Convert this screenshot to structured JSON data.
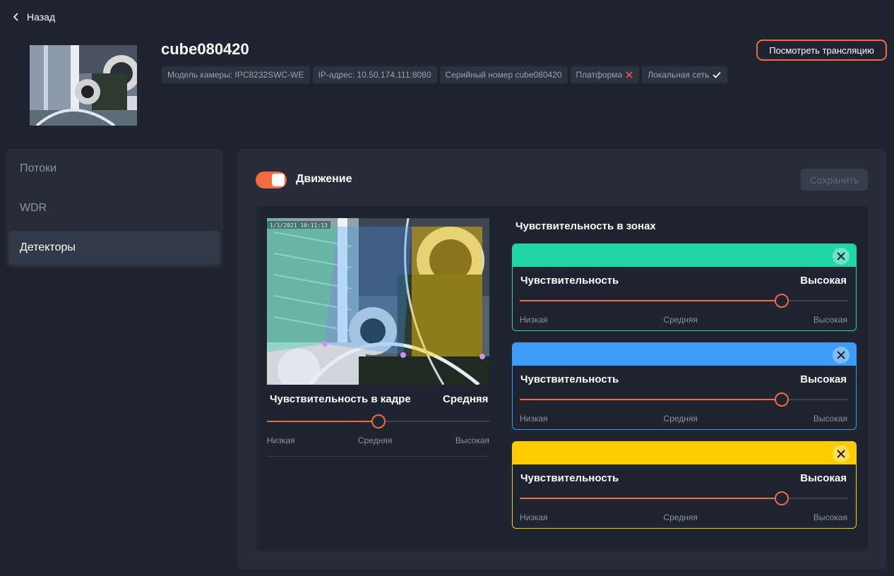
{
  "nav": {
    "back_label": "Назад"
  },
  "camera": {
    "name": "cube080420",
    "chips": [
      {
        "text": "Модель камеры: IPC8232SWC-WE",
        "icon": ""
      },
      {
        "text": "IP-адрес: 10.50.174.111:8080",
        "icon": ""
      },
      {
        "text": "Серийный номер cube080420",
        "icon": ""
      },
      {
        "text": "Платформа",
        "icon": "cross-icon"
      },
      {
        "text": "Локальная сеть",
        "icon": "check-icon"
      }
    ],
    "watch_button": "Посмотреть трансляцию"
  },
  "sidebar": {
    "items": [
      {
        "label": "Потоки",
        "active": false
      },
      {
        "label": "WDR",
        "active": false
      },
      {
        "label": "Детекторы",
        "active": true
      }
    ]
  },
  "detector": {
    "toggle_on": true,
    "title": "Движение",
    "save_label": "Сохранить",
    "preview_timestamp": "1/1/2021 10:11:13",
    "frame_sensitivity": {
      "label": "Чувствительность в кадре",
      "value": "Средняя",
      "level": 0.5,
      "scale": [
        "Низкая",
        "Средняя",
        "Высокая"
      ]
    },
    "zones_title": "Чувствительность в зонах",
    "zones": [
      {
        "color": "#1fd6a6",
        "label": "Чувствительность",
        "value": "Высокая",
        "level": 0.8,
        "scale": [
          "Низкая",
          "Средняя",
          "Высокая"
        ]
      },
      {
        "color": "#3d9cf5",
        "label": "Чувствительность",
        "value": "Высокая",
        "level": 0.8,
        "scale": [
          "Низкая",
          "Средняя",
          "Высокая"
        ]
      },
      {
        "color": "#ffcc00",
        "label": "Чувствительность",
        "value": "Высокая",
        "level": 0.8,
        "scale": [
          "Низкая",
          "Средняя",
          "Высокая"
        ]
      }
    ]
  },
  "colors": {
    "accent": "#f26a3d",
    "background": "#1e2430",
    "panel": "#262d39"
  }
}
